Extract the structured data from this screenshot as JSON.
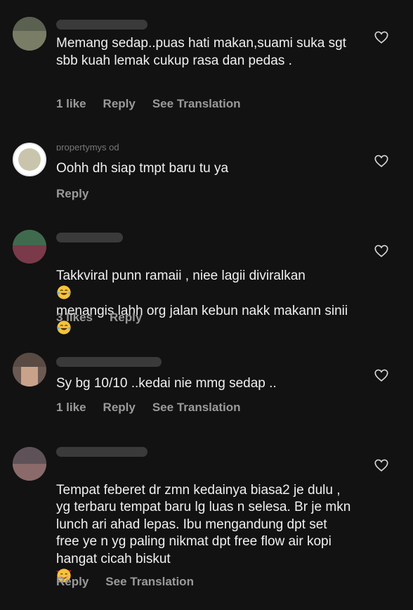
{
  "comments": [
    {
      "username": "",
      "text": "Memang sedap..puas hati makan,suami suka sgt sbb kuah lemak cukup rasa dan pedas .",
      "likes": "1 like",
      "reply": "Reply",
      "translate": "See Translation"
    },
    {
      "username": "propertymys od",
      "text": "Oohh dh siap tmpt baru tu ya",
      "reply": "Reply"
    },
    {
      "username": "",
      "text_a": "Takkviral punn ramaii , niee lagii diviralkan",
      "text_b": " menangis lahh org jalan kebun nakk makann sinii ",
      "likes": "3 likes",
      "reply": "Reply"
    },
    {
      "username": "",
      "text": "Sy bg 10/10 ..kedai nie mmg sedap ..",
      "likes": "1 like",
      "reply": "Reply",
      "translate": "See Translation"
    },
    {
      "username": "",
      "text": "Tempat feberet dr zmn kedainya biasa2 je dulu , yg terbaru tempat baru lg luas n selesa. Br je mkn lunch ari ahad lepas. Ibu mengandung dpt set free ye  n yg paling nikmat dpt free flow air kopi hangat cicah biskut ",
      "reply": "Reply",
      "translate": "See Translation"
    }
  ],
  "colors": {
    "background": "#121212",
    "text": "#f0f0f0",
    "meta": "#9a9a9a"
  },
  "icons": {
    "like": "heart-outline-icon",
    "laugh": "face-with-tears-of-joy-icon",
    "love": "smiling-face-with-hearts-icon"
  }
}
